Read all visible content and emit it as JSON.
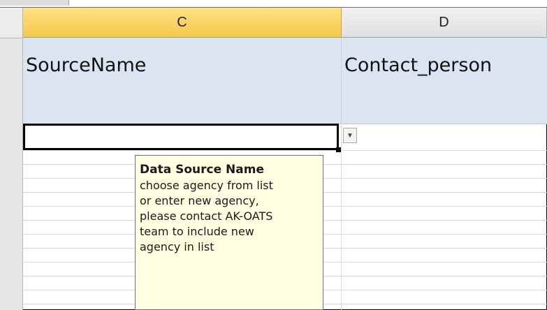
{
  "columns": {
    "c": "C",
    "d": "D"
  },
  "header_row": {
    "c": "SourceName",
    "d": "Contact_person"
  },
  "dropdown": {
    "glyph": "▼"
  },
  "tooltip": {
    "title": "Data Source Name",
    "body": "choose agency from list\nor enter new agency,\nplease contact AK-OATS\nteam to include new\nagency in list"
  },
  "colors": {
    "selected_column": "#f5c94d",
    "header_fill": "#dbe5f1",
    "tooltip_bg": "#ffffe1"
  }
}
